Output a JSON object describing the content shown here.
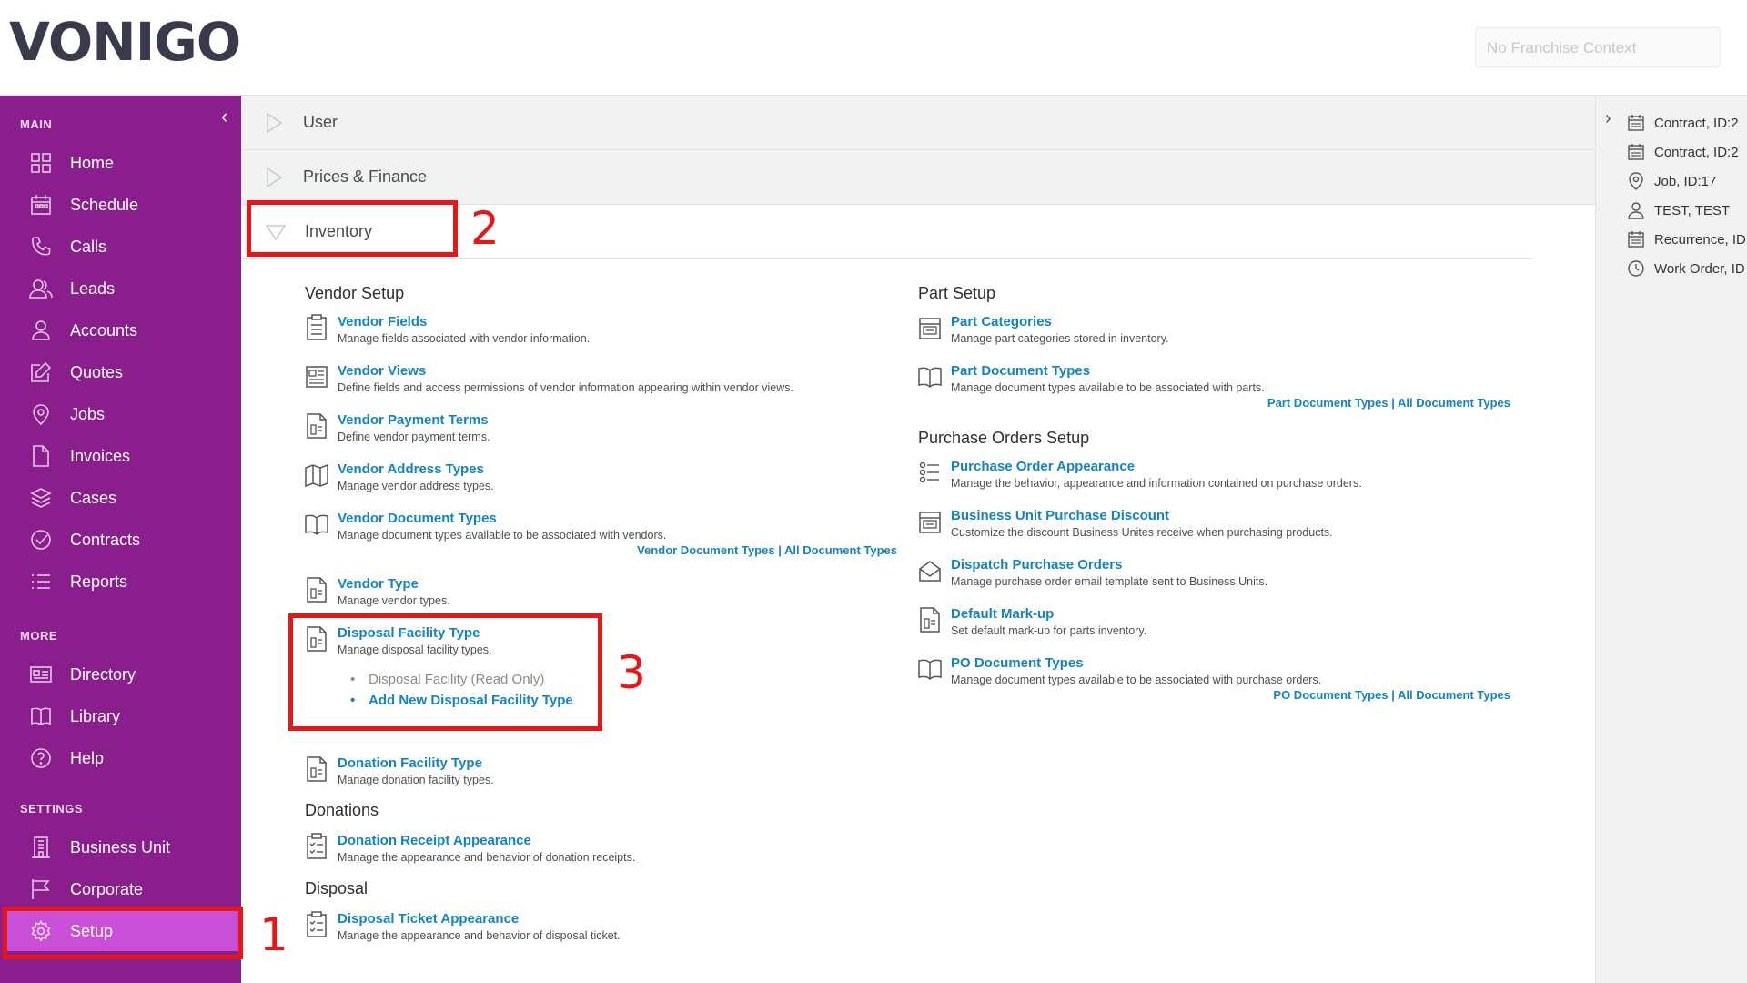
{
  "header": {
    "logo": "VONIGO",
    "franchise_placeholder": "No Franchise Context"
  },
  "sidebar": {
    "collapse_icon": "chevron-left-icon",
    "main_title": "MAIN",
    "main_items": [
      {
        "label": "Home",
        "icon": "grid-icon"
      },
      {
        "label": "Schedule",
        "icon": "calendar-icon"
      },
      {
        "label": "Calls",
        "icon": "phone-icon"
      },
      {
        "label": "Leads",
        "icon": "users-icon"
      },
      {
        "label": "Accounts",
        "icon": "user-icon"
      },
      {
        "label": "Quotes",
        "icon": "edit-icon"
      },
      {
        "label": "Jobs",
        "icon": "map-pin-icon"
      },
      {
        "label": "Invoices",
        "icon": "file-icon"
      },
      {
        "label": "Cases",
        "icon": "layers-icon"
      },
      {
        "label": "Contracts",
        "icon": "check-circle-icon"
      },
      {
        "label": "Reports",
        "icon": "list-icon"
      }
    ],
    "more_title": "MORE",
    "more_items": [
      {
        "label": "Directory",
        "icon": "directory-icon"
      },
      {
        "label": "Library",
        "icon": "book-icon"
      },
      {
        "label": "Help",
        "icon": "help-icon"
      }
    ],
    "settings_title": "SETTINGS",
    "settings_items": [
      {
        "label": "Business Unit",
        "icon": "building-icon"
      },
      {
        "label": "Corporate",
        "icon": "flag-icon"
      },
      {
        "label": "Setup",
        "icon": "gear-icon",
        "active": true
      }
    ],
    "active_color": "#c84fd6",
    "bg_color": "#8a1e8c"
  },
  "accordion": {
    "user": "User",
    "prices_finance": "Prices & Finance",
    "inventory": "Inventory"
  },
  "inventory": {
    "vendor_setup": {
      "title": "Vendor Setup",
      "items": [
        {
          "label": "Vendor Fields",
          "desc": "Manage fields associated with vendor information."
        },
        {
          "label": "Vendor Views",
          "desc": "Define fields and access permissions of vendor information appearing within vendor views."
        },
        {
          "label": "Vendor Payment Terms",
          "desc": "Define vendor payment terms."
        },
        {
          "label": "Vendor Address Types",
          "desc": "Manage vendor address types."
        },
        {
          "label": "Vendor Document Types",
          "desc": "Manage document types available to be associated with vendors."
        },
        {
          "label": "Vendor Type",
          "desc": "Manage vendor types."
        },
        {
          "label": "Disposal Facility Type",
          "desc": "Manage disposal facility types."
        },
        {
          "label": "Donation Facility Type",
          "desc": "Manage donation facility types."
        }
      ],
      "doc_links": {
        "a": "Vendor Document Types",
        "sep": " | ",
        "b": "All Document Types"
      },
      "disposal_options": {
        "read_only": "Disposal Facility (Read Only)",
        "add_new": "Add New Disposal Facility Type"
      }
    },
    "donations": {
      "title": "Donations",
      "item": {
        "label": "Donation Receipt Appearance",
        "desc": "Manage the appearance and behavior of donation receipts."
      }
    },
    "disposal": {
      "title": "Disposal",
      "item": {
        "label": "Disposal Ticket Appearance",
        "desc": "Manage the appearance and behavior of disposal ticket."
      }
    },
    "part_setup": {
      "title": "Part Setup",
      "items": [
        {
          "label": "Part Categories",
          "desc": "Manage part categories stored in inventory."
        },
        {
          "label": "Part Document Types",
          "desc": "Manage document types available to be associated with parts."
        }
      ],
      "doc_links": {
        "a": "Part Document Types",
        "sep": " | ",
        "b": "All Document Types"
      }
    },
    "po_setup": {
      "title": "Purchase Orders Setup",
      "items": [
        {
          "label": "Purchase Order Appearance",
          "desc": "Manage the behavior, appearance and information contained on purchase orders."
        },
        {
          "label": "Business Unit Purchase Discount",
          "desc": "Customize the discount Business Unites receive when purchasing products."
        },
        {
          "label": "Dispatch Purchase Orders",
          "desc": "Manage purchase order email template sent to Business Units."
        },
        {
          "label": "Default Mark-up",
          "desc": "Set default mark-up for parts inventory."
        },
        {
          "label": "PO Document Types",
          "desc": "Manage document types available to be associated with purchase orders."
        }
      ],
      "doc_links": {
        "a": "PO Document Types",
        "sep": " | ",
        "b": "All Document Types"
      }
    }
  },
  "annotations": {
    "n1": "1",
    "n2": "2",
    "n3": "3",
    "color": "#e81717"
  },
  "right_panel": {
    "items": [
      {
        "label": "Contract, ID:2",
        "icon": "calendar-icon"
      },
      {
        "label": "Contract, ID:2",
        "icon": "calendar-icon"
      },
      {
        "label": "Job, ID:17",
        "icon": "map-pin-icon"
      },
      {
        "label": "TEST, TEST",
        "icon": "user-icon"
      },
      {
        "label": "Recurrence, ID",
        "icon": "calendar-icon"
      },
      {
        "label": "Work Order, ID",
        "icon": "clock-icon"
      }
    ]
  },
  "link_color": "#1483c6"
}
